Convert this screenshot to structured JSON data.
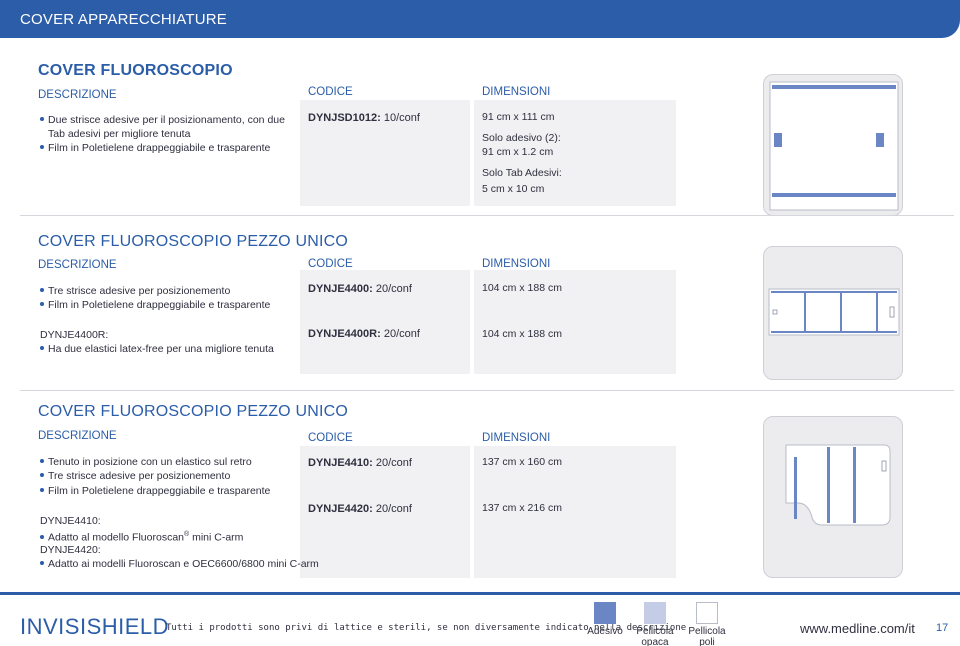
{
  "header": {
    "title": "COVER APPARECCHIATURE"
  },
  "sections": [
    {
      "title": "COVER FLUOROSCOPIO",
      "col_desc": "DESCRIZIONE",
      "col_code": "CODICE",
      "col_dim": "DIMENSIONI",
      "bullets": [
        "Due strisce adesive per il posizionamento, con due",
        "Film in Poletielene drappeggiabile e trasparente"
      ],
      "bullet1_cont": "Tab adesivi per migliore tenuta",
      "code": {
        "id": "DYNJSD1012:",
        "qty": "10/conf"
      },
      "dims": [
        "91 cm x 111 cm",
        "Solo adesivo (2):",
        "91 cm x 1.2 cm",
        "Solo Tab Adesivi:",
        "5 cm x 10 cm"
      ]
    },
    {
      "title": "COVER FLUOROSCOPIO PEZZO UNICO",
      "col_desc": "DESCRIZIONE",
      "col_code": "CODICE",
      "col_dim": "DIMENSIONI",
      "bullets": [
        "Tre strisce adesive per posizionemento",
        "Film in Poletielene drappeggiabile e trasparente"
      ],
      "variant_label": "DYNJE4400R:",
      "variant_bullet": "Ha due elastici latex-free per una migliore tenuta",
      "codes": [
        {
          "id": "DYNJE4400:",
          "qty": "20/conf",
          "dim": "104 cm x 188 cm"
        },
        {
          "id": "DYNJE4400R:",
          "qty": "20/conf",
          "dim": "104 cm x 188 cm"
        }
      ]
    },
    {
      "title": "COVER FLUOROSCOPIO PEZZO UNICO",
      "col_desc": "DESCRIZIONE",
      "col_code": "CODICE",
      "col_dim": "DIMENSIONI",
      "bullets": [
        "Tenuto in posizione con un elastico sul retro",
        "Tre strisce adesive per posizionemento",
        "Film in Poletielene drappeggiabile e trasparente"
      ],
      "variant1_label": "DYNJE4410:",
      "variant1_bullet": "Adatto al modello Fluoroscan",
      "variant1_reg": "®",
      "variant1_tail": " mini C-arm",
      "variant2_label": "DYNJE4420:",
      "variant2_bullet": "Adatto ai modelli Fluoroscan e OEC6600/6800 mini C-arm",
      "codes": [
        {
          "id": "DYNJE4410:",
          "qty": "20/conf",
          "dim": "137 cm x 160 cm"
        },
        {
          "id": "DYNJE4420:",
          "qty": "20/conf",
          "dim": "137 cm x 216 cm"
        }
      ]
    }
  ],
  "footer": {
    "brand": "INVISISHIELD",
    "note": "Tutti i prodotti sono privi di lattice e sterili, se non diversamente indicato nella descrizione",
    "legend": [
      {
        "label": "Adesivo",
        "color": "#6a86c4"
      },
      {
        "label": "Pellicola opaca",
        "color": "#c5cde6"
      },
      {
        "label": "Pellicola poli",
        "color": "#ffffff"
      }
    ],
    "url": "www.medline.com/it",
    "page": "17"
  },
  "colors": {
    "accent": "#2b5da8",
    "adhesive": "#6a86c4",
    "background": "#e6e6ea"
  }
}
